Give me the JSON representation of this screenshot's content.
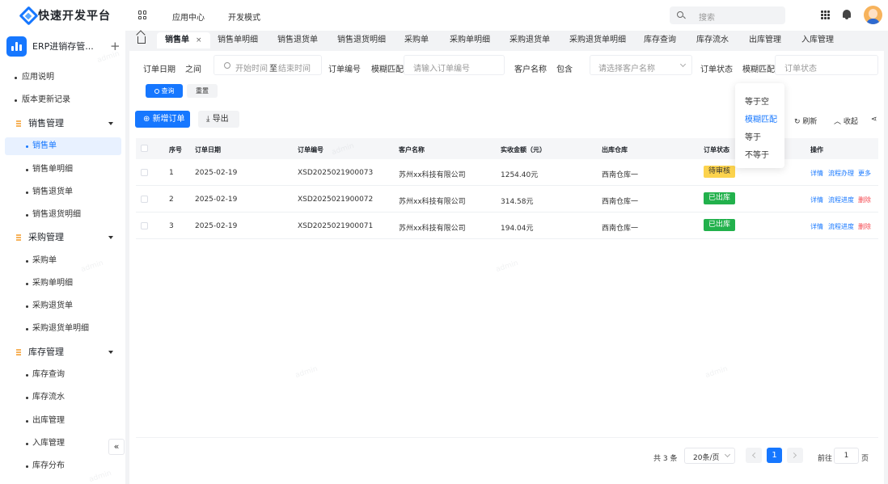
{
  "header": {
    "title": "快速开发平台",
    "nav": [
      "应用中心",
      "开发模式"
    ],
    "search_placeholder": "搜索"
  },
  "sidebar": {
    "app_name": "ERP进销存管...",
    "items": [
      {
        "label": "应用说明",
        "type": "item"
      },
      {
        "label": "版本更新记录",
        "type": "item"
      },
      {
        "label": "销售管理",
        "type": "group"
      },
      {
        "label": "销售单",
        "type": "sub",
        "active": true
      },
      {
        "label": "销售单明细",
        "type": "sub"
      },
      {
        "label": "销售退货单",
        "type": "sub"
      },
      {
        "label": "销售退货明细",
        "type": "sub"
      },
      {
        "label": "采购管理",
        "type": "group"
      },
      {
        "label": "采购单",
        "type": "sub"
      },
      {
        "label": "采购单明细",
        "type": "sub"
      },
      {
        "label": "采购退货单",
        "type": "sub"
      },
      {
        "label": "采购退货单明细",
        "type": "sub"
      },
      {
        "label": "库存管理",
        "type": "group"
      },
      {
        "label": "库存查询",
        "type": "sub"
      },
      {
        "label": "库存流水",
        "type": "sub"
      },
      {
        "label": "出库管理",
        "type": "sub"
      },
      {
        "label": "入库管理",
        "type": "sub"
      },
      {
        "label": "库存分布",
        "type": "sub"
      }
    ],
    "collapse_label": "«"
  },
  "tabs": [
    {
      "label": "销售单",
      "active": true
    },
    {
      "label": "销售单明细"
    },
    {
      "label": "销售退货单"
    },
    {
      "label": "销售退货明细"
    },
    {
      "label": "采购单"
    },
    {
      "label": "采购单明细"
    },
    {
      "label": "采购退货单"
    },
    {
      "label": "采购退货单明细"
    },
    {
      "label": "库存查询"
    },
    {
      "label": "库存流水"
    },
    {
      "label": "出库管理"
    },
    {
      "label": "入库管理"
    }
  ],
  "filters": {
    "date_label": "订单日期",
    "date_op": "之间",
    "date_start": "开始时间",
    "date_sep": "至",
    "date_end": "结束时间",
    "order_no_label": "订单编号",
    "order_no_op": "模糊匹配",
    "order_no_placeholder": "请输入订单编号",
    "customer_label": "客户名称",
    "customer_op": "包含",
    "customer_placeholder": "请选择客户名称",
    "status_label": "订单状态",
    "status_op": "模糊匹配",
    "status_placeholder": "订单状态",
    "query_button": "查询",
    "reset_button": "重置"
  },
  "dropdown": {
    "options": [
      {
        "label": "等于空"
      },
      {
        "label": "模糊匹配",
        "selected": true
      },
      {
        "label": "等于"
      },
      {
        "label": "不等于"
      }
    ]
  },
  "toolbar": {
    "add_button": "新增订单",
    "export_button": "导出",
    "refresh": "刷新",
    "collapse": "收起"
  },
  "table": {
    "columns": [
      "序号",
      "订单日期",
      "订单编号",
      "客户名称",
      "实收金额（元）",
      "出库仓库",
      "订单状态",
      "操作"
    ],
    "rows": [
      {
        "no": "1",
        "date": "2025-02-19",
        "order": "XSD2025021900073",
        "customer": "苏州xx科技有限公司",
        "amount": "1254.40元",
        "warehouse": "西南仓库一",
        "status": "待审核",
        "status_color": "#fcd34d",
        "actions": [
          "详情",
          "流程办理",
          "更多"
        ]
      },
      {
        "no": "2",
        "date": "2025-02-19",
        "order": "XSD2025021900072",
        "customer": "苏州xx科技有限公司",
        "amount": "314.58元",
        "warehouse": "西南仓库一",
        "status": "已出库",
        "status_color": "#22b14c",
        "actions": [
          "详情",
          "流程进度",
          "删除"
        ]
      },
      {
        "no": "3",
        "date": "2025-02-19",
        "order": "XSD2025021900071",
        "customer": "苏州xx科技有限公司",
        "amount": "194.04元",
        "warehouse": "西南仓库一",
        "status": "已出库",
        "status_color": "#22b14c",
        "actions": [
          "详情",
          "流程进度",
          "删除"
        ]
      }
    ]
  },
  "pagination": {
    "total": "共 3 条",
    "page_size": "20条/页",
    "current": "1",
    "goto_label": "前往",
    "goto_value": "1",
    "page_unit": "页"
  },
  "watermark": "admin"
}
